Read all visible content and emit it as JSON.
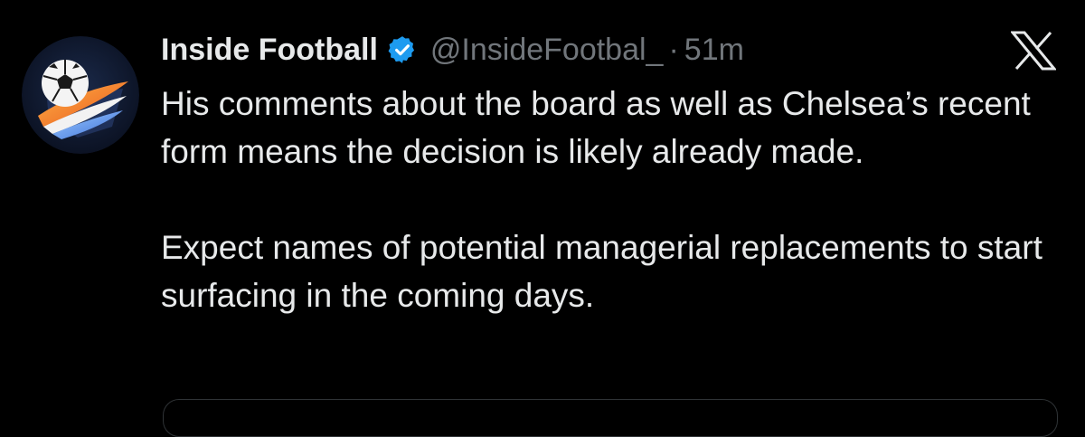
{
  "tweet": {
    "display_name": "Inside Football",
    "handle": "@InsideFootbal_",
    "separator": "·",
    "time": "51m",
    "verified": true,
    "paragraphs": [
      "His comments about the board as well as Chelsea’s recent form means the decision is likely already made.",
      "Expect names of potential managerial replacements to start surfacing in the coming days."
    ]
  },
  "icons": {
    "verified": "verified-badge-icon",
    "platform": "x-logo-icon",
    "avatar": "football-logo-avatar"
  },
  "colors": {
    "background": "#000000",
    "text": "#e7e9ea",
    "muted": "#71767b",
    "verified": "#1d9bf0"
  }
}
